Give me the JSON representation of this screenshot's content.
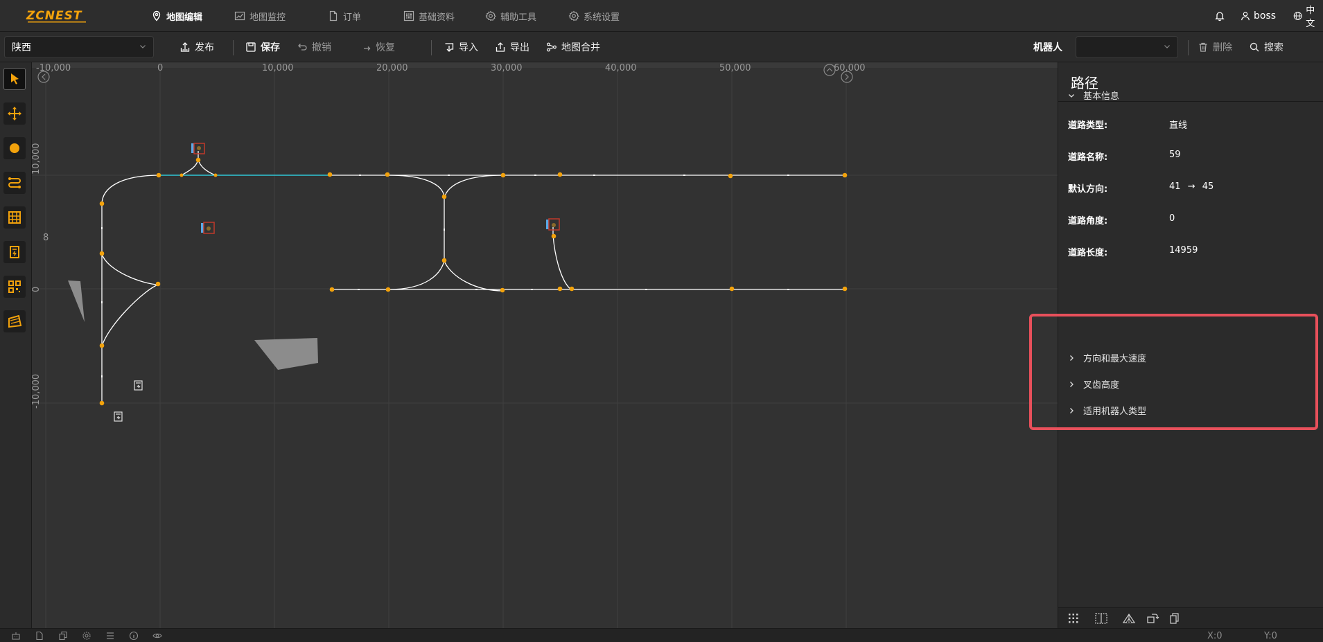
{
  "app": {
    "logo_text": "ZCNEST",
    "nav": [
      {
        "label": "地图编辑",
        "icon": "location-pin-icon",
        "active": true
      },
      {
        "label": "地图监控",
        "icon": "chart-icon",
        "active": false
      },
      {
        "label": "订单",
        "icon": "document-icon",
        "active": false
      },
      {
        "label": "基础资料",
        "icon": "sliders-icon",
        "active": false
      },
      {
        "label": "辅助工具",
        "icon": "gear-icon",
        "active": false
      },
      {
        "label": "系统设置",
        "icon": "gear-icon",
        "active": false
      }
    ],
    "user": "boss",
    "language": "中文"
  },
  "toolbar": {
    "map_select": "陕西",
    "publish": "发布",
    "save": "保存",
    "undo": "撤销",
    "redo": "恢复",
    "import": "导入",
    "export": "导出",
    "merge": "地图合并",
    "robot_label": "机器人",
    "robot_select": "",
    "delete": "删除",
    "search": "搜索"
  },
  "left_tools": [
    "select-arrow-icon",
    "move-icon",
    "point-icon",
    "path-icon",
    "shelf-icon",
    "charger-icon",
    "qrcode-icon",
    "area-icon"
  ],
  "canvas": {
    "x_ruler": [
      "-10,000",
      "0",
      "10,000",
      "20,000",
      "30,000",
      "40,000",
      "50,000",
      "60,000"
    ],
    "y_ruler": [
      "10,000",
      "0",
      "-10,000"
    ],
    "side_text": "8"
  },
  "panel": {
    "title": "路径",
    "sections": {
      "basic": "基本信息",
      "direction_speed": "方向和最大速度",
      "fork_height": "叉齿高度",
      "robot_types": "适用机器人类型"
    },
    "props": {
      "road_type_label": "道路类型:",
      "road_type": "直线",
      "road_name_label": "道路名称:",
      "road_name": "59",
      "default_dir_label": "默认方向:",
      "dir_from": "41",
      "dir_arrow": "→",
      "dir_to": "45",
      "road_angle_label": "道路角度:",
      "road_angle": "0",
      "road_length_label": "道路长度:",
      "road_length": "14959"
    }
  },
  "status": {
    "x": "X:0",
    "y": "Y:0"
  },
  "colors": {
    "accent": "#f2a20c",
    "highlight": "#e8505b",
    "selected_path": "#2fc7d8"
  }
}
